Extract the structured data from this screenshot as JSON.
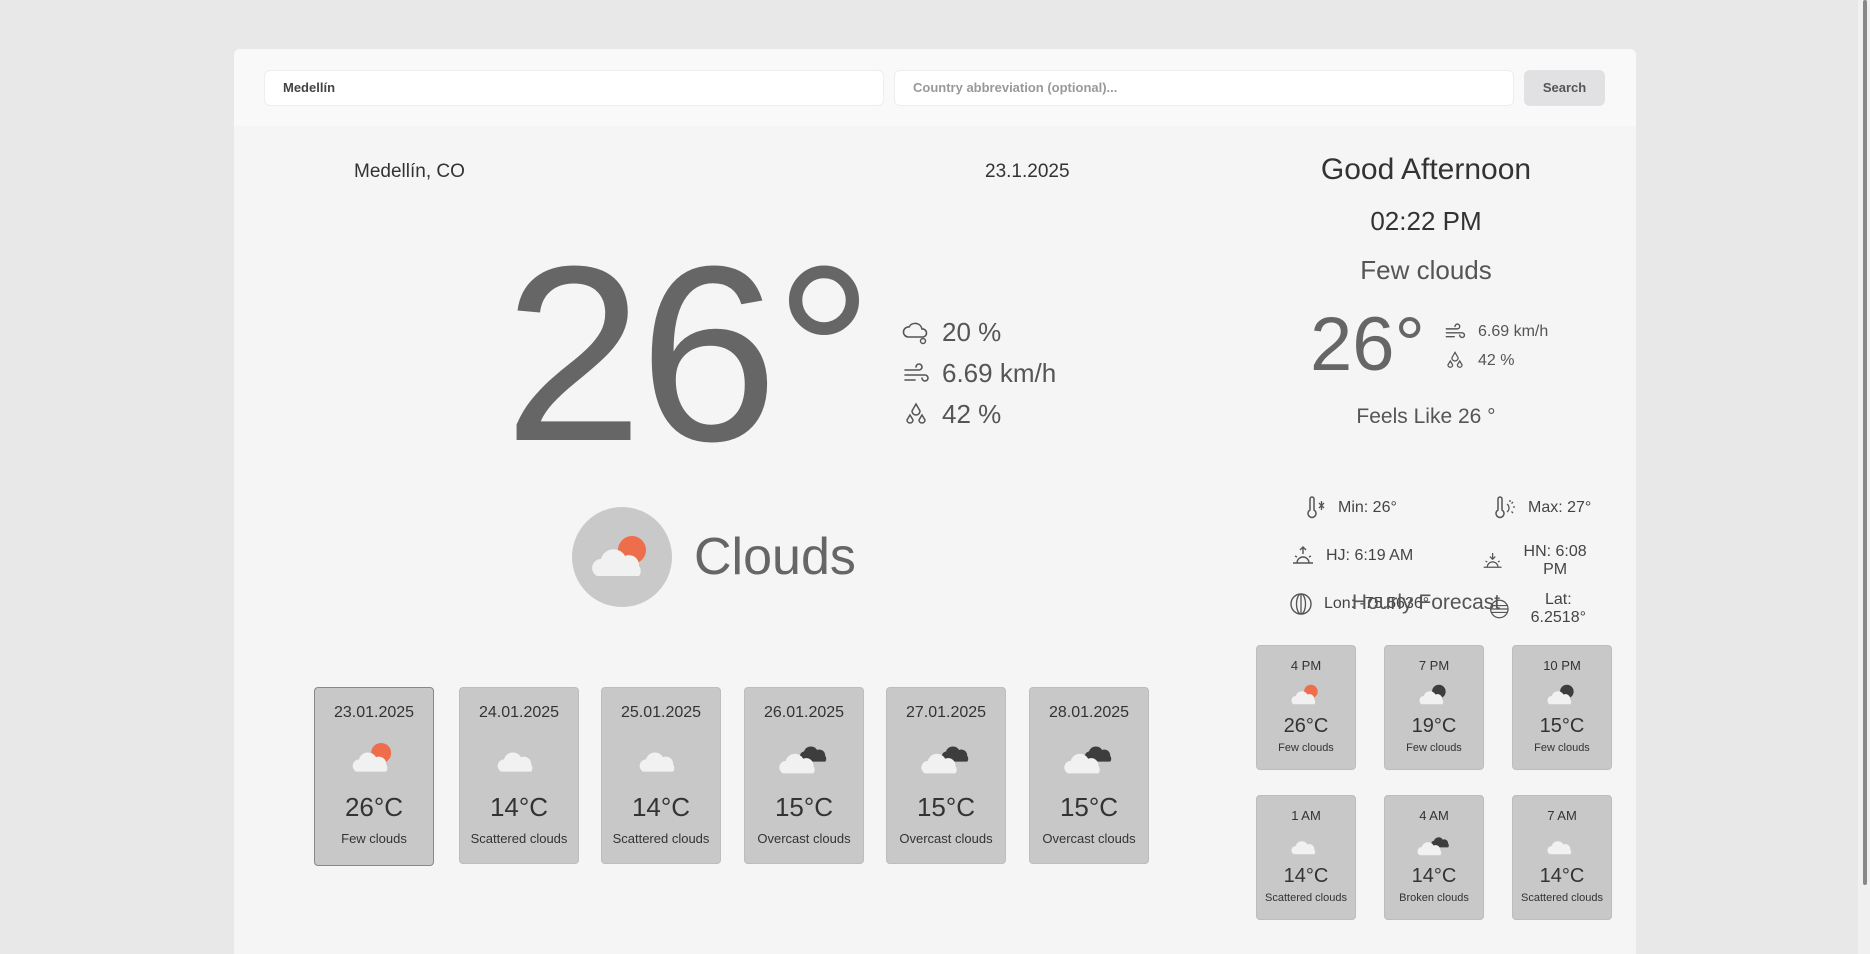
{
  "search": {
    "city_value": "Medellín",
    "country_placeholder": "Country abbreviation (optional)...",
    "button_label": "Search"
  },
  "current": {
    "location": "Medellín, CO",
    "date": "23.1.2025",
    "temp": "26°",
    "cloudiness": "20 %",
    "wind": "6.69 km/h",
    "humidity": "42 %",
    "condition": "Clouds",
    "condition_icon": "few-clouds-icon"
  },
  "daily": [
    {
      "date": "23.01.2025",
      "temp": "26°C",
      "desc": "Few clouds",
      "icon": "few-clouds-icon",
      "active": true
    },
    {
      "date": "24.01.2025",
      "temp": "14°C",
      "desc": "Scattered clouds",
      "icon": "scattered-clouds-icon"
    },
    {
      "date": "25.01.2025",
      "temp": "14°C",
      "desc": "Scattered clouds",
      "icon": "scattered-clouds-icon"
    },
    {
      "date": "26.01.2025",
      "temp": "15°C",
      "desc": "Overcast clouds",
      "icon": "overcast-clouds-icon"
    },
    {
      "date": "27.01.2025",
      "temp": "15°C",
      "desc": "Overcast clouds",
      "icon": "overcast-clouds-icon"
    },
    {
      "date": "28.01.2025",
      "temp": "15°C",
      "desc": "Overcast clouds",
      "icon": "overcast-clouds-icon"
    }
  ],
  "right": {
    "greeting": "Good Afternoon",
    "time": "02:22 PM",
    "description": "Few clouds",
    "temp": "26°",
    "wind": "6.69 km/h",
    "humidity": "42 %",
    "feels_like": "Feels Like 26 °",
    "min": "Min: 26°",
    "max": "Max: 27°",
    "sunrise": "HJ: 6:19 AM",
    "sunset": "HN: 6:08 PM",
    "lon": "Lon: -75.5636°",
    "lat": "Lat: 6.2518°",
    "hourly_title": "Hourly Forecast"
  },
  "hourly": [
    {
      "hour": "4 PM",
      "temp": "26°C",
      "desc": "Few clouds",
      "icon": "few-clouds-icon"
    },
    {
      "hour": "7 PM",
      "temp": "19°C",
      "desc": "Few clouds",
      "icon": "few-clouds-night-icon"
    },
    {
      "hour": "10 PM",
      "temp": "15°C",
      "desc": "Few clouds",
      "icon": "few-clouds-night-icon"
    },
    {
      "hour": "1 AM",
      "temp": "14°C",
      "desc": "Scattered clouds",
      "icon": "scattered-clouds-icon"
    },
    {
      "hour": "4 AM",
      "temp": "14°C",
      "desc": "Broken clouds",
      "icon": "broken-clouds-icon"
    },
    {
      "hour": "7 AM",
      "temp": "14°C",
      "desc": "Scattered clouds",
      "icon": "scattered-clouds-icon"
    }
  ],
  "colors": {
    "sun": "#ee6d4a",
    "cloud_light": "#f1f1f1",
    "cloud_dark": "#3d3d3d",
    "card_bg": "#c8c8c8"
  }
}
